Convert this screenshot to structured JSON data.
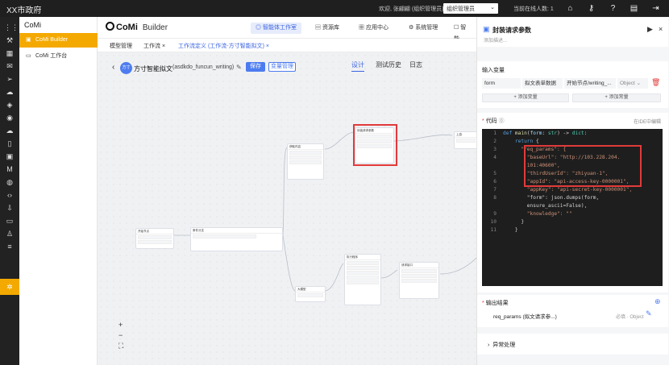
{
  "topbar": {
    "city": "XX市政府",
    "welcome": "欢迎, 张翩翩 (组织管理员) 登录",
    "org_select": "组织管理员",
    "online": "当前在线人数: 1",
    "icons": [
      "home-icon",
      "key-icon",
      "help-icon",
      "save-icon",
      "logout-icon"
    ]
  },
  "rail": {
    "icons": [
      "grid-icon",
      "wrench-icon",
      "table-icon",
      "email-icon",
      "send-icon",
      "cloud-icon",
      "layers-icon",
      "database-icon",
      "cloud2-icon",
      "file-icon",
      "apps-icon",
      "m-icon",
      "chat-icon",
      "code-icon",
      "download-icon",
      "monitor-icon",
      "person-icon",
      "stack-icon",
      "settings-icon"
    ]
  },
  "sidebar": {
    "title": "CoMi",
    "items": [
      {
        "label": "CoMi Builder",
        "icon": "bot-icon",
        "active": true
      },
      {
        "label": "CoMi 工作台",
        "icon": "desk-icon",
        "active": false
      }
    ]
  },
  "header": {
    "logo": "CoMi",
    "subtitle": "Builder",
    "nav": [
      {
        "label": "智能体工作室",
        "active": true
      },
      {
        "label": "资源库",
        "active": false
      },
      {
        "label": "应用中心",
        "active": false
      },
      {
        "label": "系统管理",
        "active": false
      },
      {
        "label": "智能",
        "active": false
      }
    ]
  },
  "tabs": [
    {
      "label": "模型管理",
      "closable": false,
      "active": false
    },
    {
      "label": "工作流",
      "closable": true,
      "active": false
    },
    {
      "label": "工作流定义 (工作流-方寸智能拟文)",
      "closable": true,
      "active": true
    }
  ],
  "workflow": {
    "badge": "方寸",
    "name": "方寸智能拟文",
    "id": "(asdkdo_funcun_writing)",
    "save": "保存",
    "var_manage": "变量管理",
    "subtabs": [
      {
        "label": "设计",
        "active": true
      },
      {
        "label": "测试历史",
        "active": false
      },
      {
        "label": "日志",
        "active": false
      }
    ]
  },
  "nodes": {
    "start": "开始节点",
    "cond": "条件分支",
    "get": "获取内容",
    "wrap": "封装请求参数",
    "out": "大模型输出",
    "mid": "大模型",
    "next": "执行程序",
    "req": "请求接口",
    "end": "上游"
  },
  "panel": {
    "title": "封装请求参数",
    "desc": "添加描述...",
    "input_label": "输入变量",
    "input_row": {
      "name": "form",
      "kind": "拟文表单数据",
      "source": "开始节点/writing_...",
      "type": "Object"
    },
    "add_var": "+ 添加变量",
    "add_const": "+ 添加常量",
    "code_label": "代码",
    "code_link": "在IDE中编辑",
    "output_label": "输出结果",
    "output_row": {
      "name": "req_params (拟文请求参...)",
      "tag": "必填 · Object"
    },
    "exception": "异常处理"
  },
  "code_lines": [
    {
      "n": "1",
      "t": "def main(form: str) -> dict:"
    },
    {
      "n": "2",
      "t": "    return {"
    },
    {
      "n": "3",
      "t": "      \"req_params\": {"
    },
    {
      "n": "4",
      "t": "        \"baseUrl\": \"http://103.228.204."
    },
    {
      "n": "",
      "t": "        101:40600\","
    },
    {
      "n": "5",
      "t": "        \"thirdUserId\": \"zhiyuan-1\","
    },
    {
      "n": "6",
      "t": "        \"appId\": \"api-access-key-0000001\","
    },
    {
      "n": "7",
      "t": "        \"appKey\": \"api-secret-key-0000001\","
    },
    {
      "n": "8",
      "t": "        \"form\": json.dumps(form,"
    },
    {
      "n": "",
      "t": "        ensure_ascii=False),"
    },
    {
      "n": "9",
      "t": "        \"knowledge\": \"\""
    },
    {
      "n": "10",
      "t": "      }"
    },
    {
      "n": "11",
      "t": "    }"
    }
  ]
}
